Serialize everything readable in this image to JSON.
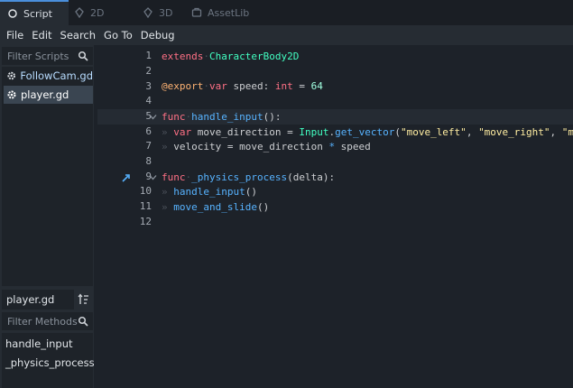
{
  "top_tabs": [
    {
      "label": "Script",
      "icon": "script-icon"
    },
    {
      "label": "2D",
      "icon": "2d-node-icon"
    },
    {
      "label": "3D",
      "icon": "3d-node-icon"
    },
    {
      "label": "AssetLib",
      "icon": "assetlib-icon"
    }
  ],
  "menu": [
    "File",
    "Edit",
    "Search",
    "Go To",
    "Debug"
  ],
  "scripts": {
    "filter_placeholder": "Filter Scripts",
    "items": [
      "FollowCam.gd",
      "player.gd"
    ],
    "selected": "player.gd"
  },
  "current_script": "player.gd",
  "methods": {
    "filter_placeholder": "Filter Methods",
    "items": [
      "handle_input",
      "_physics_process"
    ]
  },
  "code": {
    "line_numbers": [
      "1",
      "2",
      "3",
      "4",
      "5",
      "6",
      "7",
      "8",
      "9",
      "10",
      "11",
      "12"
    ],
    "l1_kw": "extends",
    "l1_type": "CharacterBody2D",
    "l3_ann": "@export",
    "l3_kw": "var",
    "l3_name": " speed: ",
    "l3_type": "int",
    "l3_eq": " = ",
    "l3_num": "64",
    "l5_kw": "func",
    "l5_fn": "handle_input",
    "l5_rest": "():",
    "l6_kw": "var",
    "l6_name": " move_direction = ",
    "l6_type": "Input",
    "l6_dot": ".",
    "l6_fn": "get_vector",
    "l6_open": "(",
    "l6_s1": "\"move_left\"",
    "l6_c1": ", ",
    "l6_s2": "\"move_right\"",
    "l6_c2": ", ",
    "l6_s3": "\"move",
    "l7_text": "velocity = move_direction ",
    "l7_op": "*",
    "l7_end": " speed",
    "l9_kw": "func",
    "l9_fn": "_physics_process",
    "l9_rest": "(delta):",
    "l10_fn": "handle_input",
    "l10_rest": "()",
    "l11_fn": "move_and_slide",
    "l11_rest": "()"
  }
}
